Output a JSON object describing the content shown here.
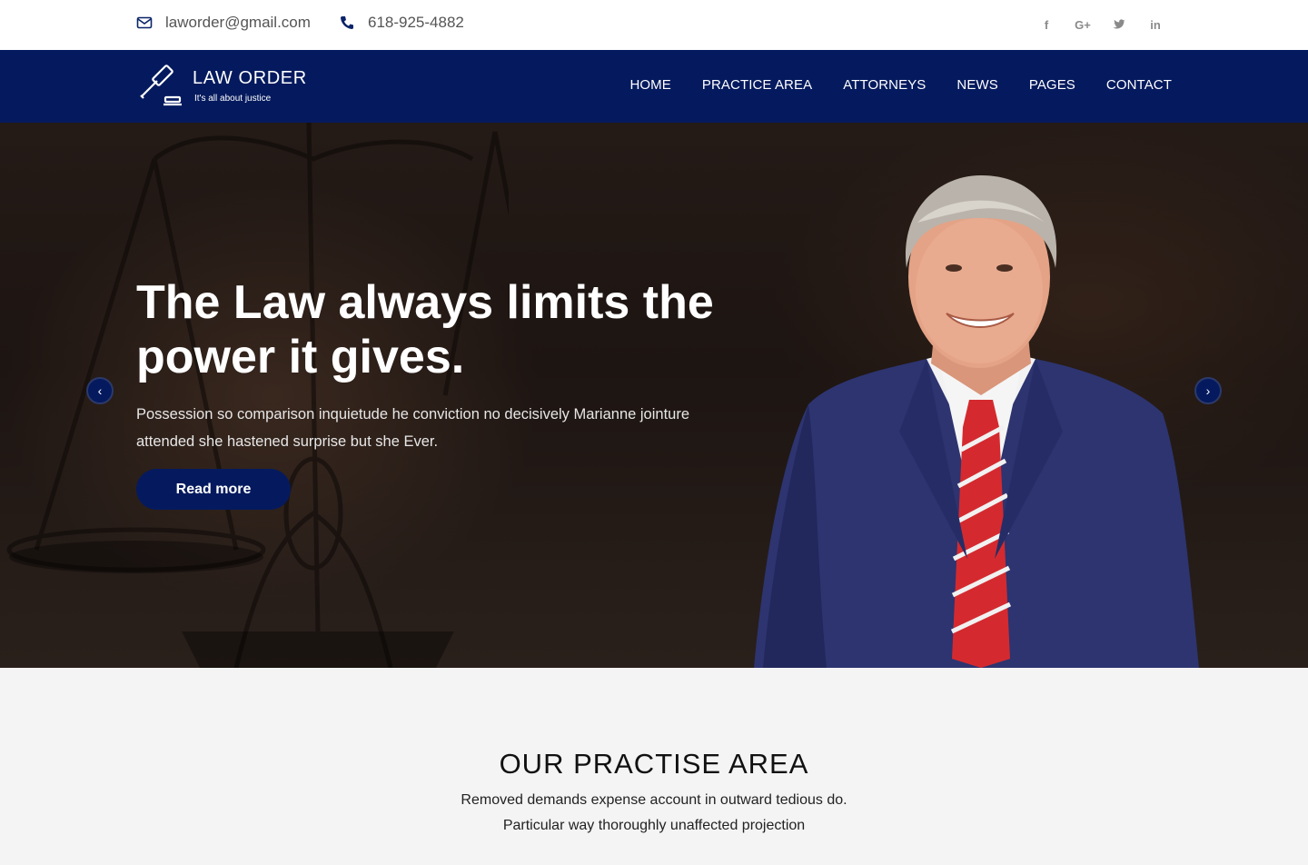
{
  "topbar": {
    "email": "laworder@gmail.com",
    "phone": "618-925-4882",
    "socials": [
      {
        "icon": "facebook-icon",
        "label": "f"
      },
      {
        "icon": "google-plus-icon",
        "label": "G+"
      },
      {
        "icon": "twitter-icon",
        "label": "t"
      },
      {
        "icon": "linkedin-icon",
        "label": "in"
      }
    ]
  },
  "navbar": {
    "brand": "LAW ORDER",
    "tagline": "It's all about justice",
    "menu": [
      "HOME",
      "PRACTICE AREA",
      "ATTORNEYS",
      "NEWS",
      "PAGES",
      "CONTACT"
    ]
  },
  "hero": {
    "title": "The Law always limits the power it gives.",
    "text": "Possession so comparison inquietude he conviction no decisively Marianne jointure attended she hastened surprise but she Ever.",
    "button": "Read more",
    "prev_arrow": "‹",
    "next_arrow": "›"
  },
  "practice": {
    "heading": "OUR PRACTISE AREA",
    "text": "Removed demands expense account in outward tedious do. Particular way thoroughly unaffected projection"
  },
  "colors": {
    "navy": "#051a5e",
    "topbar_bg": "#ffffff",
    "section_bg": "#f4f4f4"
  }
}
